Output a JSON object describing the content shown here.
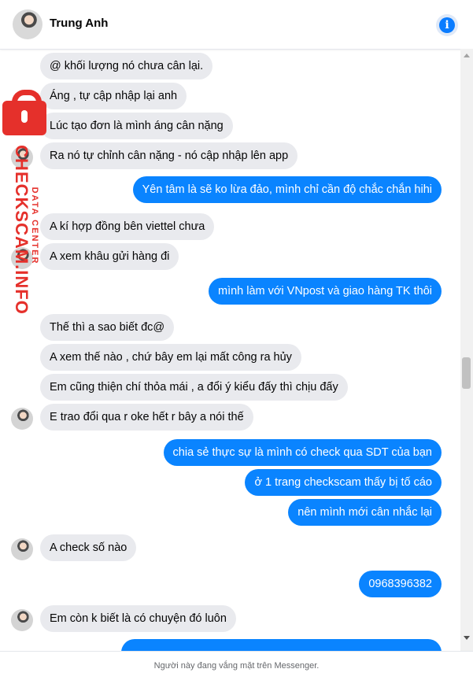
{
  "header": {
    "contact_name": "Trung Anh"
  },
  "messages": [
    {
      "text": "@ khối lượng nó chưa cân lại.",
      "dir": "in"
    },
    {
      "text": "Áng , tự cập nhập lại anh",
      "dir": "in"
    },
    {
      "text": "Lúc tạo đơn là mình áng cân nặng",
      "dir": "in"
    },
    {
      "text": "Ra nó tự chỉnh cân nặng - nó cập nhập lên app",
      "dir": "in"
    },
    {
      "text": "Yên tâm là sẽ ko lừa đảo, mình chỉ cần độ chắc chắn hihi",
      "dir": "out"
    },
    {
      "text": "A kí hợp đồng bên viettel chưa",
      "dir": "in"
    },
    {
      "text": "A xem khâu gửi hàng đi",
      "dir": "in"
    },
    {
      "text": "mình làm với VNpost và giao hàng TK thôi",
      "dir": "out"
    },
    {
      "text": "Thế thì a sao biết đc@",
      "dir": "in"
    },
    {
      "text": "A xem thế nào , chứ bây em lại mất công ra hủy",
      "dir": "in"
    },
    {
      "text": "Em cũng thiện chí thỏa mái , a đổi ý kiểu đấy thì chịu đấy",
      "dir": "in"
    },
    {
      "text": "E trao đổi qua r oke hết r bây a nói thế",
      "dir": "in"
    },
    {
      "text": "chia sẻ thực sự là mình có check qua SDT của bạn",
      "dir": "out"
    },
    {
      "text": "ở 1 trang checkscam thấy bị tố cáo",
      "dir": "out"
    },
    {
      "text": "nên mình mới cân nhắc lại",
      "dir": "out"
    },
    {
      "text": "A check số nào",
      "dir": "in"
    },
    {
      "text": "0968396382",
      "dir": "out"
    },
    {
      "text": "Em còn k biết là có chuyện đó luôn",
      "dir": "in"
    }
  ],
  "footer": {
    "status_text": "Người này đang vắng mặt trên Messenger."
  },
  "watermark": {
    "main": "CHECKSCAM.INFO",
    "sub": "DATA CENTER"
  },
  "colors": {
    "outgoing_bubble": "#0a84ff",
    "incoming_bubble": "#e9eaee",
    "watermark": "#e5302b"
  }
}
